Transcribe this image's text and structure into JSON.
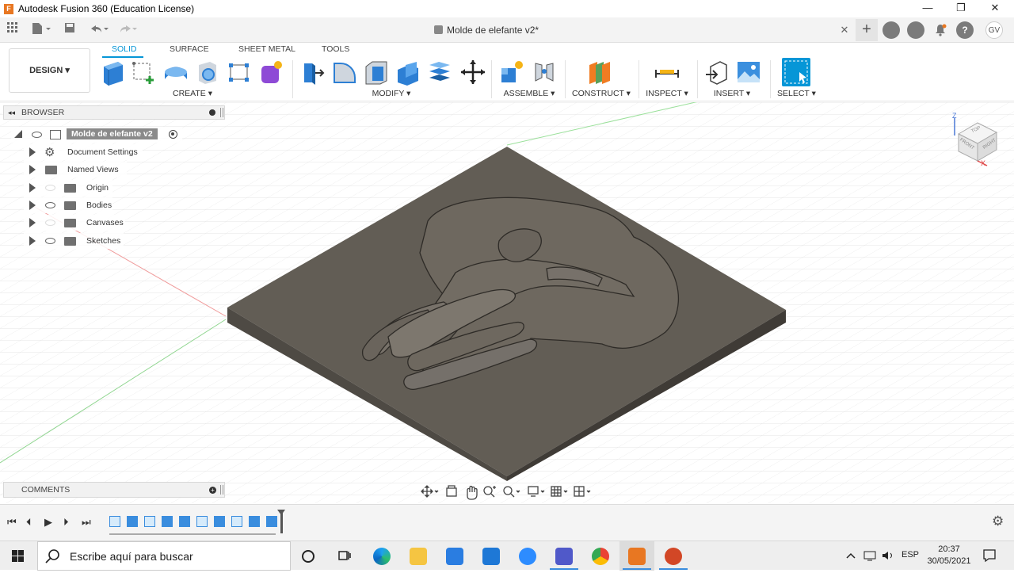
{
  "window": {
    "title": "Autodesk Fusion 360 (Education License)",
    "minimize": "—",
    "restore": "❐",
    "close": "✕"
  },
  "qat": {
    "grid_icon": "grid-icon",
    "file_icon": "file-icon",
    "save_icon": "save-icon",
    "undo_icon": "undo-icon",
    "redo_icon": "redo-icon",
    "doc_title": "Molde de elefante v2*",
    "close_tab": "✕",
    "add_tab": "+",
    "user_initials": "GV"
  },
  "ribbon": {
    "workspace": "DESIGN ▾",
    "tabs": [
      {
        "label": "SOLID"
      },
      {
        "label": "SURFACE"
      },
      {
        "label": "SHEET METAL"
      },
      {
        "label": "TOOLS"
      }
    ],
    "groups": [
      {
        "label": "CREATE ▾"
      },
      {
        "label": "MODIFY ▾"
      },
      {
        "label": "ASSEMBLE ▾"
      },
      {
        "label": "CONSTRUCT ▾"
      },
      {
        "label": "INSPECT ▾"
      },
      {
        "label": "INSERT ▾"
      },
      {
        "label": "SELECT ▾"
      }
    ]
  },
  "browser": {
    "header": "BROWSER",
    "root": "Molde de elefante v2",
    "items": [
      {
        "label": "Document Settings"
      },
      {
        "label": "Named Views"
      },
      {
        "label": "Origin"
      },
      {
        "label": "Bodies"
      },
      {
        "label": "Canvases"
      },
      {
        "label": "Sketches"
      }
    ]
  },
  "comments": {
    "label": "COMMENTS"
  },
  "viewcube": {
    "top": "TOP",
    "front": "FRONT",
    "right": "RIGHT",
    "z": "Z",
    "x": "X"
  },
  "timeline": {
    "first": "⏮",
    "prev": "⏴",
    "play": "▶",
    "next": "⏵",
    "last": "⏭",
    "settings": "⚙"
  },
  "taskbar": {
    "search_placeholder": "Escribe aquí para buscar",
    "lang": "ESP",
    "time": "20:37",
    "date": "30/05/2021"
  },
  "colors": {
    "accent": "#0696d7",
    "model": "#6b655c",
    "model_top": "#5f5a52",
    "grid": "#d4d4d4"
  }
}
